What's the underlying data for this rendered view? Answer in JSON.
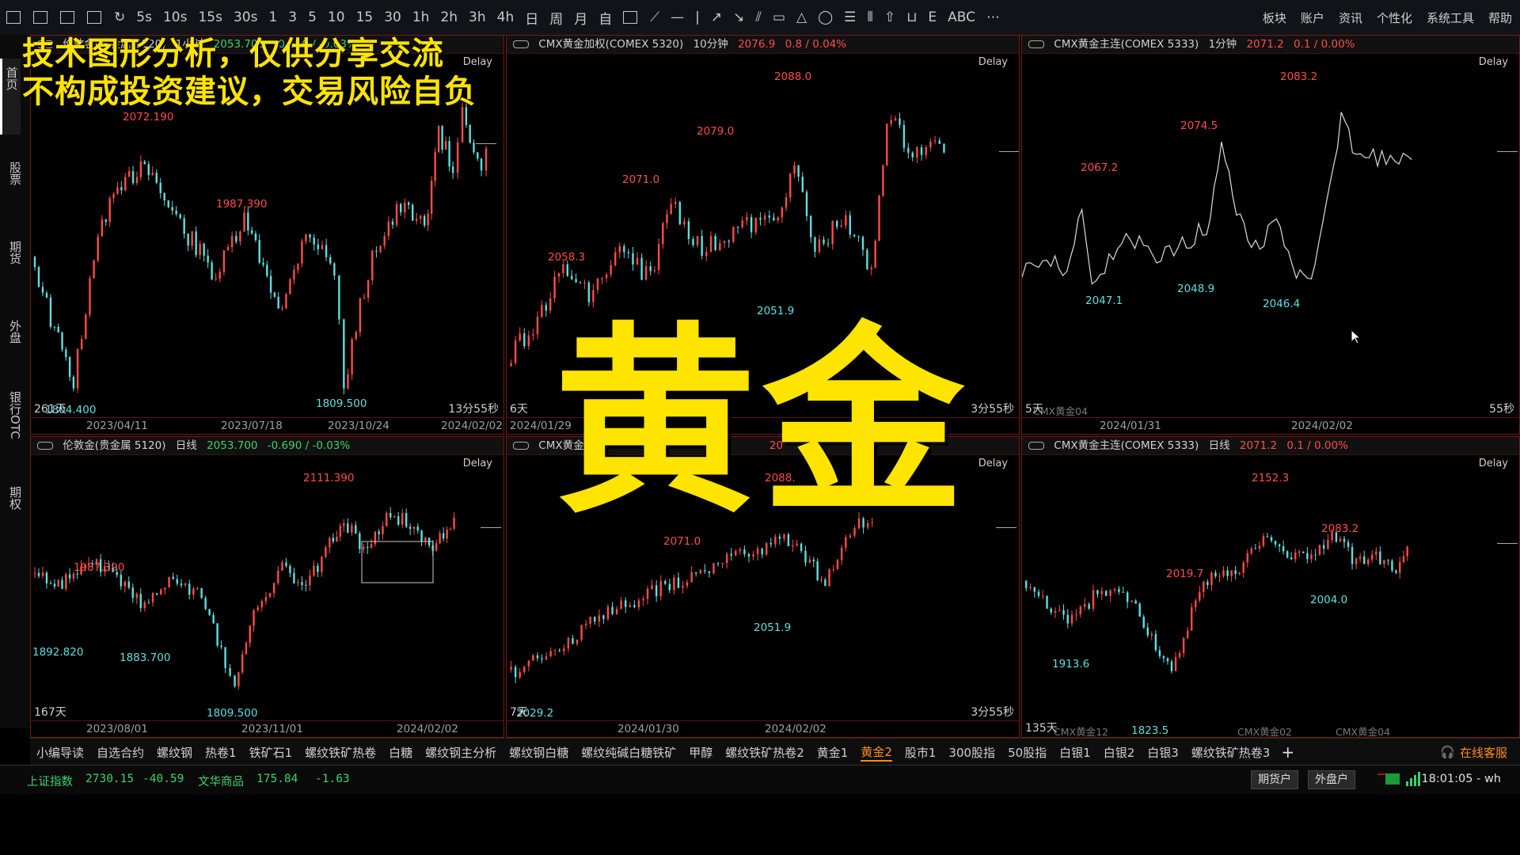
{
  "toolbar": {
    "periods": [
      "5s",
      "10s",
      "15s",
      "30s",
      "1",
      "3",
      "5",
      "10",
      "15",
      "30",
      "1h",
      "2h",
      "3h",
      "4h",
      "日",
      "周",
      "月",
      "自"
    ],
    "right_label": "ABC",
    "menu": [
      "板块",
      "账户",
      "资讯",
      "个性化",
      "系统工具",
      "帮助"
    ]
  },
  "sidebar": {
    "items": [
      "首页",
      "股票",
      "期货",
      "外盘",
      "银行OTC",
      "期权"
    ]
  },
  "overlay": {
    "line1": "技术图形分析，仅供分享交流",
    "line2": "不构成投资建议，交易风险自负",
    "big_title": "黄金"
  },
  "panels": [
    {
      "header": {
        "name": "伦敦金(贵金属 5120)",
        "period": "1小时",
        "price": "2053.700",
        "change": "-0.690 / -0.03%"
      },
      "delay": "Delay",
      "corner_left": "261天",
      "corner_right": "13分55秒",
      "x_labels": [
        "2023/04/11",
        "2023/07/18",
        "2023/10/24",
        "2024/02/02"
      ],
      "labels": [
        {
          "text": "2072.190",
          "type": "h"
        },
        {
          "text": "1987.390",
          "type": "h"
        },
        {
          "text": "1809.500",
          "type": "l"
        },
        {
          "text": "1804.400",
          "type": "l"
        }
      ]
    },
    {
      "header": {
        "name": "CMX黄金加权(COMEX 5320)",
        "period": "10分钟",
        "price": "2076.9",
        "change": "0.8 / 0.04%"
      },
      "delay": "Delay",
      "corner_left": "6天",
      "corner_right": "3分55秒",
      "x_labels": [
        "2024/01/29"
      ],
      "labels": [
        {
          "text": "2088.0",
          "type": "h"
        },
        {
          "text": "2079.0",
          "type": "h"
        },
        {
          "text": "2071.0",
          "type": "h"
        },
        {
          "text": "2058.3",
          "type": "h"
        },
        {
          "text": "2051.9",
          "type": "l"
        }
      ]
    },
    {
      "header": {
        "name": "CMX黄金主连(COMEX 5333)",
        "period": "1分钟",
        "price": "2071.2",
        "change": "0.1 / 0.00%"
      },
      "delay": "Delay",
      "corner_left": "5天",
      "corner_right": "55秒",
      "contract": "CMX黄金04",
      "x_labels": [
        "2024/01/31",
        "2024/02/02"
      ],
      "labels": [
        {
          "text": "2083.2",
          "type": "h"
        },
        {
          "text": "2074.5",
          "type": "h"
        },
        {
          "text": "2067.2",
          "type": "h"
        },
        {
          "text": "2047.1",
          "type": "l"
        },
        {
          "text": "2048.9",
          "type": "l"
        },
        {
          "text": "2046.4",
          "type": "l"
        }
      ]
    },
    {
      "header": {
        "name": "伦敦金(贵金属 5120)",
        "period": "日线",
        "price": "2053.700",
        "change": "-0.690 / -0.03%"
      },
      "delay": "Delay",
      "corner_left": "167天",
      "x_labels": [
        "2023/08/01",
        "2023/11/01",
        "2024/02/02"
      ],
      "labels": [
        {
          "text": "2111.390",
          "type": "h"
        },
        {
          "text": "1987.390",
          "type": "h"
        },
        {
          "text": "1892.820",
          "type": "l"
        },
        {
          "text": "1883.700",
          "type": "l"
        },
        {
          "text": "1809.500",
          "type": "l"
        }
      ]
    },
    {
      "header": {
        "name": "CMX黄金",
        "price": "20"
      },
      "delay": "Delay",
      "corner_left": "7天",
      "corner_right": "3分55秒",
      "x_labels": [
        "2024/01/30",
        "2024/02/02"
      ],
      "labels": [
        {
          "text": "2088.",
          "type": "h"
        },
        {
          "text": "2071.0",
          "type": "h"
        },
        {
          "text": "2051.9",
          "type": "l"
        },
        {
          "text": "2029.2",
          "type": "l"
        }
      ]
    },
    {
      "header": {
        "name": "CMX黄金主连(COMEX 5333)",
        "period": "日线",
        "price": "2071.2",
        "change": "0.1 / 0.00%"
      },
      "delay": "Delay",
      "corner_left": "135天",
      "contracts": [
        "CMX黄金12",
        "CMX黄金02",
        "CMX黄金04"
      ],
      "labels": [
        {
          "text": "2152.3",
          "type": "h"
        },
        {
          "text": "2019.7",
          "type": "h"
        },
        {
          "text": "2083.2",
          "type": "h"
        },
        {
          "text": "2004.0",
          "type": "l"
        },
        {
          "text": "1913.6",
          "type": "l"
        },
        {
          "text": "1823.5",
          "type": "l"
        }
      ]
    }
  ],
  "tabs": [
    "小编导读",
    "自选合约",
    "螺纹钢",
    "热卷1",
    "铁矿石1",
    "螺纹铁矿热卷",
    "白糖",
    "螺纹钢主分析",
    "螺纹钢白糖",
    "螺纹纯碱白糖铁矿",
    "甲醇",
    "螺纹铁矿热卷2",
    "黄金1",
    "黄金2",
    "股市1",
    "300股指",
    "50股指",
    "白银1",
    "白银2",
    "白银3",
    "螺纹铁矿热卷3"
  ],
  "active_tab": "黄金2",
  "service": "在线客服",
  "status": {
    "idx1_name": "上证指数",
    "idx1_value": "2730.15",
    "idx1_change": "-40.59",
    "idx2_name": "文华商品",
    "idx2_value": "175.84",
    "idx2_change": "-1.63",
    "btn1": "期货户",
    "btn2": "外盘户",
    "time": "18:01:05 - wh"
  },
  "colors": {
    "up": "#ff4b4b",
    "down": "#5ee0e0",
    "accent": "#ffe400",
    "active_tab": "#ff8c1a",
    "panel_border": "#7a1717"
  }
}
